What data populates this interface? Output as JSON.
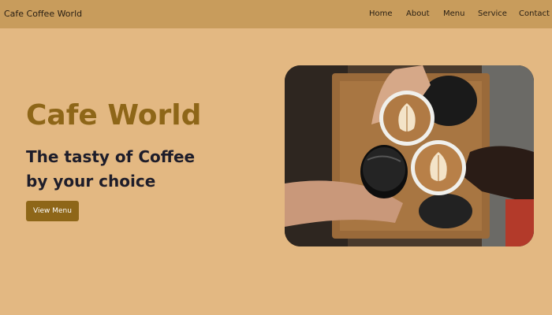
{
  "navbar": {
    "brand": "Cafe Coffee World",
    "links": [
      "Home",
      "About",
      "Menu",
      "Service",
      "Contact"
    ]
  },
  "hero": {
    "title": "Cafe World",
    "subtitle": "The tasty of Coffee by your choice",
    "button_label": "View Menu",
    "image": "coffee-cups-cheers-photo"
  },
  "colors": {
    "page_background": "#e3b882",
    "navbar_background": "#c89c5c",
    "accent": "#8e6618",
    "heading_dark": "#1e1d2a"
  }
}
